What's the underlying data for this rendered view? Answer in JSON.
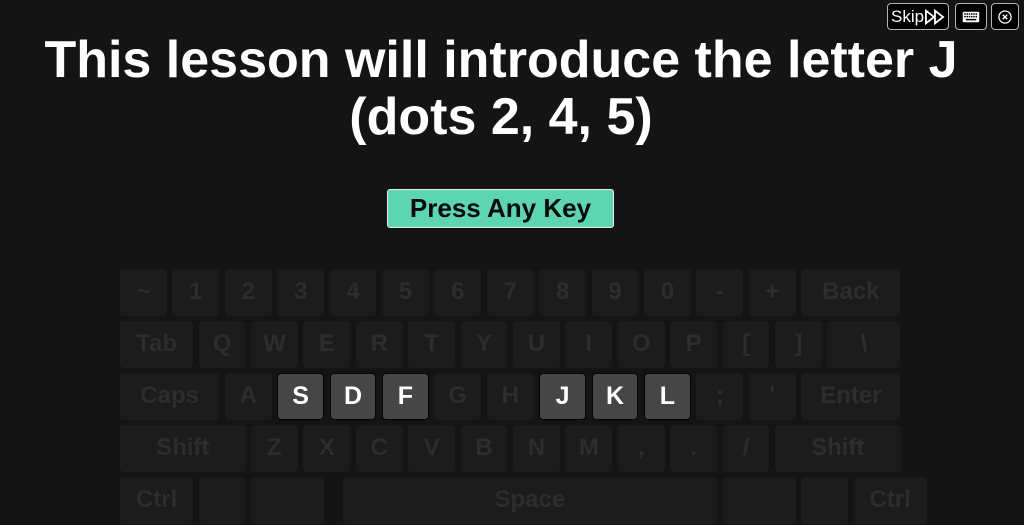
{
  "toolbar": {
    "skip_label": "Skip",
    "skip_icon": "fast-forward-icon",
    "keyboard_icon": "keyboard-icon",
    "close_icon": "close-circle-icon"
  },
  "lesson": {
    "title_line1": "This lesson will introduce the letter J",
    "title_line2": "(dots 2, 4, 5)",
    "press_label": "Press Any Key"
  },
  "colors": {
    "background": "#141414",
    "accent": "#5cd5b0",
    "key": "#1c1c1c",
    "key_highlight": "#464646"
  },
  "keyboard": {
    "rows": [
      [
        {
          "label": "~",
          "w": 1
        },
        {
          "label": "1",
          "w": 1
        },
        {
          "label": "2",
          "w": 1
        },
        {
          "label": "3",
          "w": 1
        },
        {
          "label": "4",
          "w": 1
        },
        {
          "label": "5",
          "w": 1
        },
        {
          "label": "6",
          "w": 1
        },
        {
          "label": "7",
          "w": 1
        },
        {
          "label": "8",
          "w": 1
        },
        {
          "label": "9",
          "w": 1
        },
        {
          "label": "0",
          "w": 1
        },
        {
          "label": "-",
          "w": 1
        },
        {
          "label": "+",
          "w": 1
        },
        {
          "label": "Back",
          "w": 2
        }
      ],
      [
        {
          "label": "Tab",
          "w": 1.5
        },
        {
          "label": "Q",
          "w": 1
        },
        {
          "label": "W",
          "w": 1
        },
        {
          "label": "E",
          "w": 1
        },
        {
          "label": "R",
          "w": 1
        },
        {
          "label": "T",
          "w": 1
        },
        {
          "label": "Y",
          "w": 1
        },
        {
          "label": "U",
          "w": 1
        },
        {
          "label": "I",
          "w": 1
        },
        {
          "label": "O",
          "w": 1
        },
        {
          "label": "P",
          "w": 1
        },
        {
          "label": "[",
          "w": 1
        },
        {
          "label": "]",
          "w": 1
        },
        {
          "label": "\\",
          "w": 1.5
        }
      ],
      [
        {
          "label": "Caps",
          "w": 2
        },
        {
          "label": "A",
          "w": 1
        },
        {
          "label": "S",
          "w": 1,
          "highlight": true
        },
        {
          "label": "D",
          "w": 1,
          "highlight": true
        },
        {
          "label": "F",
          "w": 1,
          "highlight": true
        },
        {
          "label": "G",
          "w": 1
        },
        {
          "label": "H",
          "w": 1
        },
        {
          "label": "J",
          "w": 1,
          "highlight": true
        },
        {
          "label": "K",
          "w": 1,
          "highlight": true
        },
        {
          "label": "L",
          "w": 1,
          "highlight": true
        },
        {
          "label": ";",
          "w": 1
        },
        {
          "label": "'",
          "w": 1
        },
        {
          "label": "Enter",
          "w": 2
        }
      ],
      [
        {
          "label": "Shift",
          "w": 2.5
        },
        {
          "label": "Z",
          "w": 1
        },
        {
          "label": "X",
          "w": 1
        },
        {
          "label": "C",
          "w": 1
        },
        {
          "label": "V",
          "w": 1
        },
        {
          "label": "B",
          "w": 1
        },
        {
          "label": "N",
          "w": 1
        },
        {
          "label": "M",
          "w": 1
        },
        {
          "label": ",",
          "w": 1
        },
        {
          "label": ".",
          "w": 1
        },
        {
          "label": "/",
          "w": 1
        },
        {
          "label": "Shift",
          "w": 2.5
        }
      ],
      [
        {
          "label": "Ctrl",
          "w": 1.5
        },
        {
          "label": "",
          "w": 1
        },
        {
          "label": "",
          "w": 1.5
        },
        {
          "label": "Space",
          "w": 7.25,
          "gap_before": 0.25
        },
        {
          "label": "",
          "w": 1.5
        },
        {
          "label": "",
          "w": 1
        },
        {
          "label": "Ctrl",
          "w": 1.5
        }
      ]
    ]
  }
}
